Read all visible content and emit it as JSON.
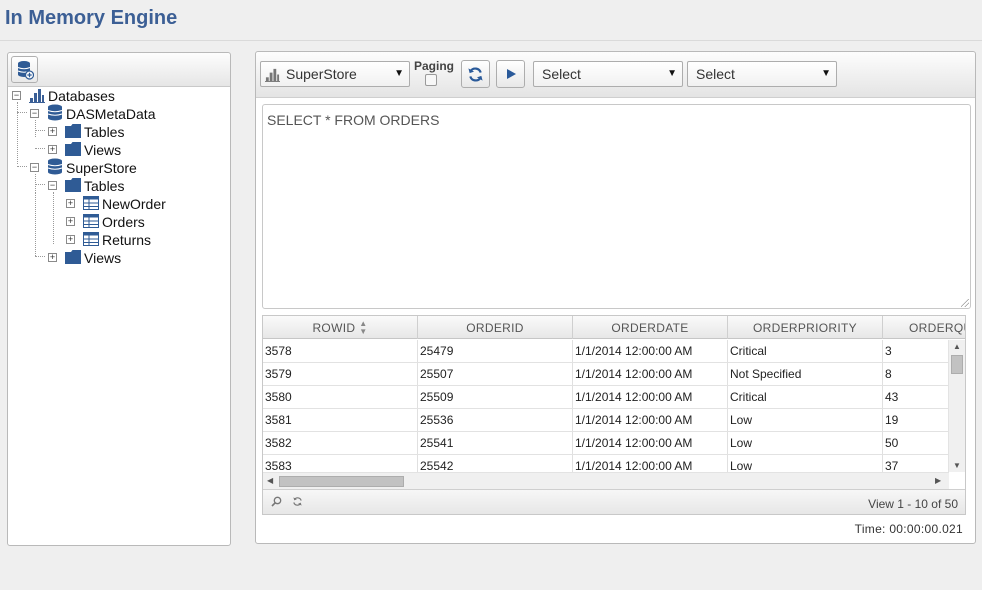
{
  "app": {
    "title": "In Memory Engine"
  },
  "tree": {
    "root": {
      "label": "Databases",
      "icon": "databases-icon"
    },
    "nodes": [
      {
        "label": "DASMetaData",
        "type": "database"
      },
      {
        "label": "Tables",
        "type": "folder"
      },
      {
        "label": "Views",
        "type": "folder"
      },
      {
        "label": "SuperStore",
        "type": "database"
      },
      {
        "label": "Tables",
        "type": "folder"
      },
      {
        "label": "NewOrder",
        "type": "table"
      },
      {
        "label": "Orders",
        "type": "table"
      },
      {
        "label": "Returns",
        "type": "table"
      },
      {
        "label": "Views",
        "type": "folder"
      }
    ]
  },
  "toolbar": {
    "database_select": "SuperStore",
    "paging_label": "Paging",
    "paging_checked": false,
    "select1": "Select",
    "select2": "Select"
  },
  "query": {
    "text": "SELECT * FROM ORDERS"
  },
  "grid": {
    "columns": [
      "ROWID",
      "ORDERID",
      "ORDERDATE",
      "ORDERPRIORITY",
      "ORDERQU"
    ],
    "rows": [
      [
        "3578",
        "25479",
        "1/1/2014 12:00:00 AM",
        "Critical",
        "3"
      ],
      [
        "3579",
        "25507",
        "1/1/2014 12:00:00 AM",
        "Not Specified",
        "8"
      ],
      [
        "3580",
        "25509",
        "1/1/2014 12:00:00 AM",
        "Critical",
        "43"
      ],
      [
        "3581",
        "25536",
        "1/1/2014 12:00:00 AM",
        "Low",
        "19"
      ],
      [
        "3582",
        "25541",
        "1/1/2014 12:00:00 AM",
        "Low",
        "50"
      ],
      [
        "3583",
        "25542",
        "1/1/2014 12:00:00 AM",
        "Low",
        "37"
      ]
    ],
    "pager_info": "View 1 - 10 of 50"
  },
  "status": {
    "time": "Time: 00:00:00.021"
  },
  "colors": {
    "title": "#3c5f95",
    "icon_blue": "#2f5b95",
    "accent_button": "#2a5a9a"
  }
}
